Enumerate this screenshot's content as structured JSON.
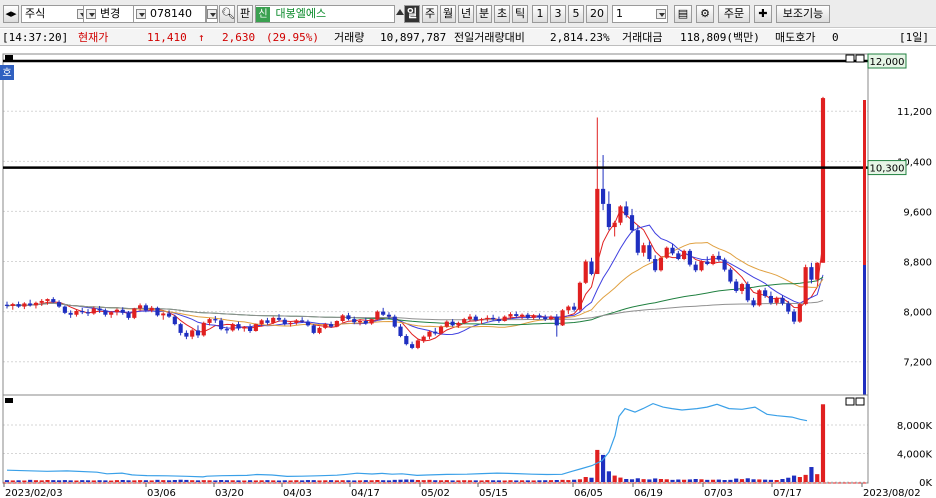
{
  "toolbar": {
    "market": "주식",
    "mode": "변경",
    "code": "078140",
    "search_icon": "search-icon",
    "pan_label": "판",
    "sin_badge": "신",
    "stock_name": "대봉엘에스",
    "periods": [
      "일",
      "주",
      "월",
      "년",
      "분",
      "초",
      "틱"
    ],
    "active_period": "일",
    "intervals": [
      "1",
      "3",
      "5",
      "20"
    ],
    "interval_value": "1",
    "order_label": "주문",
    "aux_label": "보조기능",
    "icons": [
      "save-icon",
      "gear-icon",
      "plus-icon"
    ]
  },
  "info": {
    "time": "[14:37:20]",
    "price_label": "현재가",
    "price": "11,410",
    "arrow": "↑",
    "change": "2,630",
    "change_pct": "(29.95%)",
    "volume_label": "거래량",
    "volume": "10,897,787",
    "prev_ratio_label": "전일거래량대비",
    "prev_ratio": "2,814.23%",
    "amount_label": "거래대금",
    "amount": "118,809(백만)",
    "ask_label": "매도호가",
    "ask": "0",
    "period_tag": "[1일]"
  },
  "chart_data": {
    "type": "candlestick",
    "price_axis": {
      "ticks": [
        "12,000",
        "11,200",
        "10,400",
        "9,600",
        "8,800",
        "8,000",
        "7,200"
      ],
      "range": [
        6700,
        12050
      ]
    },
    "price_highlights": {
      "top_value": "12,000",
      "line_value": "10,300",
      "line_price": 10300
    },
    "side_tag": "호",
    "date_labels": [
      "2023/02/03",
      "03/06",
      "03/20",
      "04/03",
      "04/17",
      "05/02",
      "05/15",
      "06/05",
      "06/19",
      "07/03",
      "07/17",
      "2023/08/02"
    ],
    "candles_ohlc": [
      [
        8110,
        8160,
        8050,
        8090
      ],
      [
        8090,
        8140,
        8030,
        8120
      ],
      [
        8120,
        8160,
        8060,
        8080
      ],
      [
        8080,
        8150,
        8040,
        8130
      ],
      [
        8130,
        8190,
        8080,
        8100
      ],
      [
        8100,
        8160,
        8050,
        8140
      ],
      [
        8140,
        8200,
        8090,
        8170
      ],
      [
        8170,
        8210,
        8110,
        8200
      ],
      [
        8200,
        8230,
        8140,
        8150
      ],
      [
        8150,
        8180,
        8060,
        8080
      ],
      [
        8080,
        8100,
        7960,
        7980
      ],
      [
        7980,
        8020,
        7900,
        7950
      ],
      [
        7950,
        8040,
        7920,
        8010
      ],
      [
        8010,
        8060,
        7960,
        7990
      ],
      [
        7990,
        8040,
        7930,
        7970
      ],
      [
        7970,
        8080,
        7950,
        8050
      ],
      [
        8050,
        8090,
        7980,
        8020
      ],
      [
        8020,
        8050,
        7920,
        7950
      ],
      [
        7950,
        8010,
        7900,
        7990
      ],
      [
        7990,
        8050,
        7940,
        8030
      ],
      [
        8030,
        8070,
        7950,
        7980
      ],
      [
        7980,
        8010,
        7870,
        7900
      ],
      [
        7900,
        8060,
        7880,
        8050
      ],
      [
        8050,
        8130,
        8020,
        8100
      ],
      [
        8100,
        8130,
        7990,
        8020
      ],
      [
        8020,
        8090,
        7990,
        8060
      ],
      [
        8060,
        8080,
        7920,
        7940
      ],
      [
        7940,
        7990,
        7870,
        7970
      ],
      [
        7970,
        8020,
        7900,
        7920
      ],
      [
        7920,
        7950,
        7780,
        7800
      ],
      [
        7800,
        7820,
        7620,
        7660
      ],
      [
        7660,
        7700,
        7560,
        7600
      ],
      [
        7600,
        7720,
        7560,
        7700
      ],
      [
        7700,
        7780,
        7580,
        7620
      ],
      [
        7620,
        7840,
        7600,
        7820
      ],
      [
        7820,
        7900,
        7780,
        7880
      ],
      [
        7880,
        7930,
        7820,
        7860
      ],
      [
        7860,
        7900,
        7700,
        7720
      ],
      [
        7720,
        7760,
        7650,
        7700
      ],
      [
        7700,
        7820,
        7680,
        7800
      ],
      [
        7800,
        7840,
        7700,
        7730
      ],
      [
        7730,
        7770,
        7680,
        7760
      ],
      [
        7760,
        7800,
        7660,
        7690
      ],
      [
        7690,
        7810,
        7680,
        7800
      ],
      [
        7800,
        7880,
        7760,
        7860
      ],
      [
        7860,
        7900,
        7790,
        7820
      ],
      [
        7820,
        7920,
        7800,
        7900
      ],
      [
        7900,
        7960,
        7840,
        7870
      ],
      [
        7870,
        7900,
        7780,
        7800
      ],
      [
        7800,
        7850,
        7760,
        7820
      ],
      [
        7820,
        7880,
        7790,
        7860
      ],
      [
        7860,
        7910,
        7820,
        7840
      ],
      [
        7840,
        7870,
        7760,
        7780
      ],
      [
        7780,
        7800,
        7640,
        7660
      ],
      [
        7660,
        7760,
        7640,
        7740
      ],
      [
        7740,
        7820,
        7720,
        7800
      ],
      [
        7800,
        7840,
        7740,
        7760
      ],
      [
        7760,
        7860,
        7750,
        7850
      ],
      [
        7850,
        7960,
        7830,
        7940
      ],
      [
        7940,
        7980,
        7860,
        7880
      ],
      [
        7880,
        7920,
        7800,
        7830
      ],
      [
        7830,
        7880,
        7780,
        7850
      ],
      [
        7850,
        7900,
        7790,
        7810
      ],
      [
        7810,
        7890,
        7790,
        7880
      ],
      [
        7880,
        8020,
        7860,
        8000
      ],
      [
        8000,
        8060,
        7930,
        7950
      ],
      [
        7950,
        7990,
        7880,
        7920
      ],
      [
        7920,
        7950,
        7740,
        7760
      ],
      [
        7760,
        7800,
        7590,
        7610
      ],
      [
        7610,
        7640,
        7460,
        7480
      ],
      [
        7480,
        7520,
        7400,
        7420
      ],
      [
        7420,
        7560,
        7400,
        7540
      ],
      [
        7540,
        7620,
        7500,
        7600
      ],
      [
        7600,
        7700,
        7560,
        7680
      ],
      [
        7680,
        7740,
        7620,
        7650
      ],
      [
        7650,
        7780,
        7630,
        7760
      ],
      [
        7760,
        7860,
        7740,
        7840
      ],
      [
        7840,
        7880,
        7760,
        7780
      ],
      [
        7780,
        7840,
        7740,
        7820
      ],
      [
        7820,
        7900,
        7800,
        7880
      ],
      [
        7880,
        7960,
        7850,
        7920
      ],
      [
        7920,
        7950,
        7840,
        7860
      ],
      [
        7860,
        7900,
        7800,
        7880
      ],
      [
        7880,
        7940,
        7840,
        7900
      ],
      [
        7900,
        7950,
        7860,
        7880
      ],
      [
        7880,
        7920,
        7820,
        7850
      ],
      [
        7850,
        7940,
        7840,
        7920
      ],
      [
        7920,
        7990,
        7880,
        7960
      ],
      [
        7960,
        8000,
        7900,
        7930
      ],
      [
        7930,
        7970,
        7880,
        7950
      ],
      [
        7950,
        7980,
        7880,
        7900
      ],
      [
        7900,
        7960,
        7870,
        7940
      ],
      [
        7940,
        7970,
        7880,
        7910
      ],
      [
        7910,
        7950,
        7850,
        7880
      ],
      [
        7880,
        7940,
        7860,
        7920
      ],
      [
        7920,
        7960,
        7600,
        7780
      ],
      [
        7780,
        8040,
        7770,
        8020
      ],
      [
        8020,
        8100,
        7960,
        8080
      ],
      [
        8080,
        8140,
        8000,
        8030
      ],
      [
        8030,
        8480,
        8000,
        8460
      ],
      [
        8460,
        8830,
        8440,
        8800
      ],
      [
        8800,
        8860,
        8580,
        8600
      ],
      [
        8600,
        11100,
        8600,
        9960
      ],
      [
        9960,
        10500,
        9620,
        9720
      ],
      [
        9720,
        9920,
        9300,
        9350
      ],
      [
        9350,
        9450,
        9200,
        9420
      ],
      [
        9420,
        9700,
        9380,
        9680
      ],
      [
        9680,
        9760,
        9500,
        9540
      ],
      [
        9540,
        9640,
        9260,
        9300
      ],
      [
        9300,
        9380,
        8900,
        8940
      ],
      [
        8940,
        9100,
        8880,
        9060
      ],
      [
        9060,
        9120,
        8800,
        8840
      ],
      [
        8840,
        8900,
        8630,
        8660
      ],
      [
        8660,
        8880,
        8640,
        8860
      ],
      [
        8860,
        9040,
        8840,
        9020
      ],
      [
        9020,
        9080,
        8900,
        8930
      ],
      [
        8930,
        8970,
        8820,
        8840
      ],
      [
        8840,
        8990,
        8820,
        8970
      ],
      [
        8970,
        9000,
        8720,
        8750
      ],
      [
        8750,
        8800,
        8630,
        8660
      ],
      [
        8660,
        8820,
        8640,
        8800
      ],
      [
        8800,
        8880,
        8740,
        8760
      ],
      [
        8760,
        8920,
        8740,
        8890
      ],
      [
        8890,
        8960,
        8800,
        8830
      ],
      [
        8830,
        8860,
        8640,
        8670
      ],
      [
        8670,
        8700,
        8450,
        8480
      ],
      [
        8480,
        8520,
        8300,
        8330
      ],
      [
        8330,
        8460,
        8280,
        8440
      ],
      [
        8440,
        8480,
        8150,
        8180
      ],
      [
        8180,
        8220,
        8070,
        8100
      ],
      [
        8100,
        8360,
        8080,
        8340
      ],
      [
        8340,
        8380,
        8220,
        8250
      ],
      [
        8250,
        8320,
        8110,
        8140
      ],
      [
        8140,
        8240,
        8100,
        8220
      ],
      [
        8220,
        8260,
        8100,
        8130
      ],
      [
        8130,
        8170,
        7960,
        8000
      ],
      [
        8000,
        8040,
        7800,
        7840
      ],
      [
        7840,
        8140,
        7820,
        8120
      ],
      [
        8120,
        8750,
        8100,
        8710
      ],
      [
        8710,
        8780,
        8450,
        8510
      ],
      [
        8510,
        8790,
        8480,
        8780
      ],
      [
        8780,
        11430,
        8780,
        11410
      ]
    ],
    "moving_averages": [
      {
        "color": "#e02020",
        "period": 5
      },
      {
        "color": "#4040e0",
        "period": 10
      },
      {
        "color": "#e0a040",
        "period": 20
      },
      {
        "color": "#208040",
        "period": 60
      },
      {
        "color": "#909090",
        "period": 120
      }
    ],
    "volume_axis": {
      "ticks": [
        "8,000K",
        "4,000K",
        "0K"
      ],
      "range": [
        0,
        11500
      ]
    },
    "volume_k": [
      260,
      220,
      240,
      210,
      300,
      250,
      230,
      280,
      260,
      240,
      270,
      230,
      210,
      260,
      240,
      220,
      250,
      230,
      200,
      260,
      280,
      240,
      230,
      260,
      250,
      220,
      300,
      260,
      240,
      280,
      320,
      290,
      250,
      230,
      260,
      240,
      220,
      280,
      250,
      240,
      230,
      210,
      250,
      220,
      240,
      260,
      230,
      210,
      240,
      220,
      250,
      230,
      270,
      260,
      220,
      240,
      260,
      230,
      250,
      240,
      220,
      230,
      260,
      240,
      280,
      250,
      230,
      300,
      320,
      350,
      330,
      280,
      260,
      300,
      250,
      240,
      260,
      220,
      230,
      250,
      240,
      230,
      220,
      260,
      240,
      230,
      210,
      250,
      220,
      240,
      230,
      220,
      240,
      250,
      260,
      280,
      300,
      270,
      320,
      380,
      700,
      600,
      4500,
      3800,
      1500,
      900,
      620,
      420,
      380,
      520,
      400,
      360,
      500,
      420,
      380,
      300,
      350,
      320,
      360,
      420,
      380,
      300,
      320,
      340,
      280,
      300,
      480,
      400,
      520,
      380,
      360,
      330,
      300,
      280,
      420,
      600,
      900,
      700,
      1000,
      2100,
      1100,
      10900
    ],
    "turnover_line": [
      [
        0,
        1650
      ],
      [
        40,
        1500
      ],
      [
        60,
        1560
      ],
      [
        90,
        1380
      ],
      [
        100,
        1150
      ],
      [
        115,
        1250
      ],
      [
        125,
        1000
      ],
      [
        130,
        960
      ],
      [
        140,
        900
      ],
      [
        160,
        870
      ],
      [
        180,
        800
      ],
      [
        196,
        720
      ],
      [
        200,
        820
      ],
      [
        215,
        880
      ],
      [
        240,
        930
      ],
      [
        250,
        1050
      ],
      [
        265,
        980
      ],
      [
        280,
        780
      ],
      [
        295,
        820
      ],
      [
        310,
        870
      ],
      [
        330,
        950
      ],
      [
        340,
        1080
      ],
      [
        350,
        1230
      ],
      [
        365,
        1120
      ],
      [
        375,
        1200
      ],
      [
        385,
        1100
      ],
      [
        395,
        1150
      ],
      [
        410,
        920
      ],
      [
        420,
        980
      ],
      [
        440,
        1060
      ],
      [
        460,
        1100
      ],
      [
        475,
        1180
      ],
      [
        490,
        1250
      ],
      [
        510,
        1180
      ],
      [
        525,
        1100
      ],
      [
        540,
        1050
      ],
      [
        555,
        1080
      ],
      [
        565,
        1500
      ],
      [
        575,
        1900
      ],
      [
        585,
        2300
      ],
      [
        595,
        3000
      ],
      [
        602,
        4200
      ],
      [
        608,
        6500
      ],
      [
        612,
        9200
      ],
      [
        618,
        10300
      ],
      [
        628,
        9800
      ],
      [
        636,
        10300
      ],
      [
        646,
        11000
      ],
      [
        656,
        10500
      ],
      [
        665,
        10300
      ],
      [
        675,
        10100
      ],
      [
        690,
        10300
      ],
      [
        700,
        10500
      ],
      [
        710,
        10900
      ],
      [
        722,
        10300
      ],
      [
        735,
        10200
      ],
      [
        748,
        10500
      ],
      [
        760,
        9500
      ],
      [
        770,
        9300
      ],
      [
        785,
        9100
      ],
      [
        793,
        8800
      ],
      [
        800,
        8600
      ]
    ]
  }
}
